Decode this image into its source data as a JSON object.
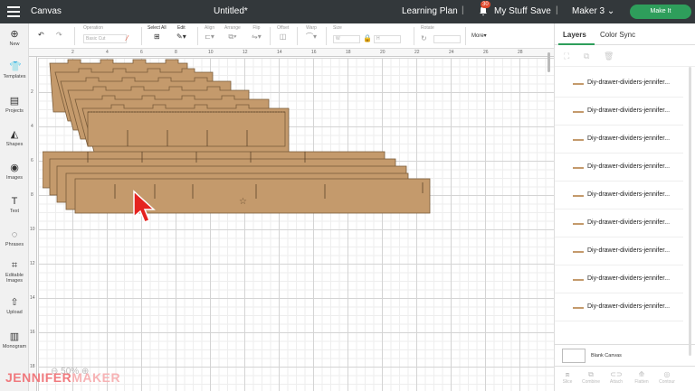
{
  "topbar": {
    "app_title": "Canvas",
    "doc_title": "Untitled*",
    "learning_plan": "Learning Plan",
    "notification_count": "30",
    "my_stuff": "My Stuff",
    "save": "Save",
    "machine": "Maker 3",
    "make_it": "Make It"
  },
  "sidebar": {
    "items": [
      {
        "label": "New",
        "icon": "plus-circle-icon"
      },
      {
        "label": "Templates",
        "icon": "shirt-icon"
      },
      {
        "label": "Projects",
        "icon": "folder-icon"
      },
      {
        "label": "Shapes",
        "icon": "shapes-icon"
      },
      {
        "label": "Images",
        "icon": "lightbulb-icon"
      },
      {
        "label": "Text",
        "icon": "text-icon"
      },
      {
        "label": "Phrases",
        "icon": "chat-icon"
      },
      {
        "label": "Editable Images",
        "icon": "crop-icon"
      },
      {
        "label": "Upload",
        "icon": "upload-icon"
      },
      {
        "label": "Monogram",
        "icon": "monogram-icon"
      }
    ]
  },
  "toolbar": {
    "operation": "Operation",
    "operation_value": "Basic Cut",
    "select_all": "Select All",
    "edit": "Edit",
    "align": "Align",
    "arrange": "Arrange",
    "flip": "Flip",
    "offset": "Offset",
    "warp": "Warp",
    "size": "Size",
    "size_w": "W",
    "size_h": "H",
    "rotate": "Rotate",
    "more": "More"
  },
  "canvas": {
    "ruler_top": [
      "2",
      "4",
      "6",
      "8",
      "10",
      "12",
      "14",
      "16",
      "18",
      "20",
      "22",
      "24",
      "26",
      "28"
    ],
    "ruler_left": [
      "2",
      "4",
      "6",
      "8",
      "10",
      "12",
      "14",
      "16",
      "18"
    ],
    "zoom": "50%"
  },
  "panel": {
    "tab_layers": "Layers",
    "tab_color_sync": "Color Sync",
    "layers": [
      "Diy-drawer-dividers-jennifer...",
      "Diy-drawer-dividers-jennifer...",
      "Diy-drawer-dividers-jennifer...",
      "Diy-drawer-dividers-jennifer...",
      "Diy-drawer-dividers-jennifer...",
      "Diy-drawer-dividers-jennifer...",
      "Diy-drawer-dividers-jennifer...",
      "Diy-drawer-dividers-jennifer...",
      "Diy-drawer-dividers-jennifer..."
    ],
    "layer_color": "#c49a6c",
    "blank_canvas": "Blank Canvas",
    "tools": [
      "Slice",
      "Combine",
      "Attach",
      "Flatten",
      "Contour"
    ]
  },
  "watermark": {
    "part1": "JENNIFER",
    "part2": "MAKER"
  }
}
